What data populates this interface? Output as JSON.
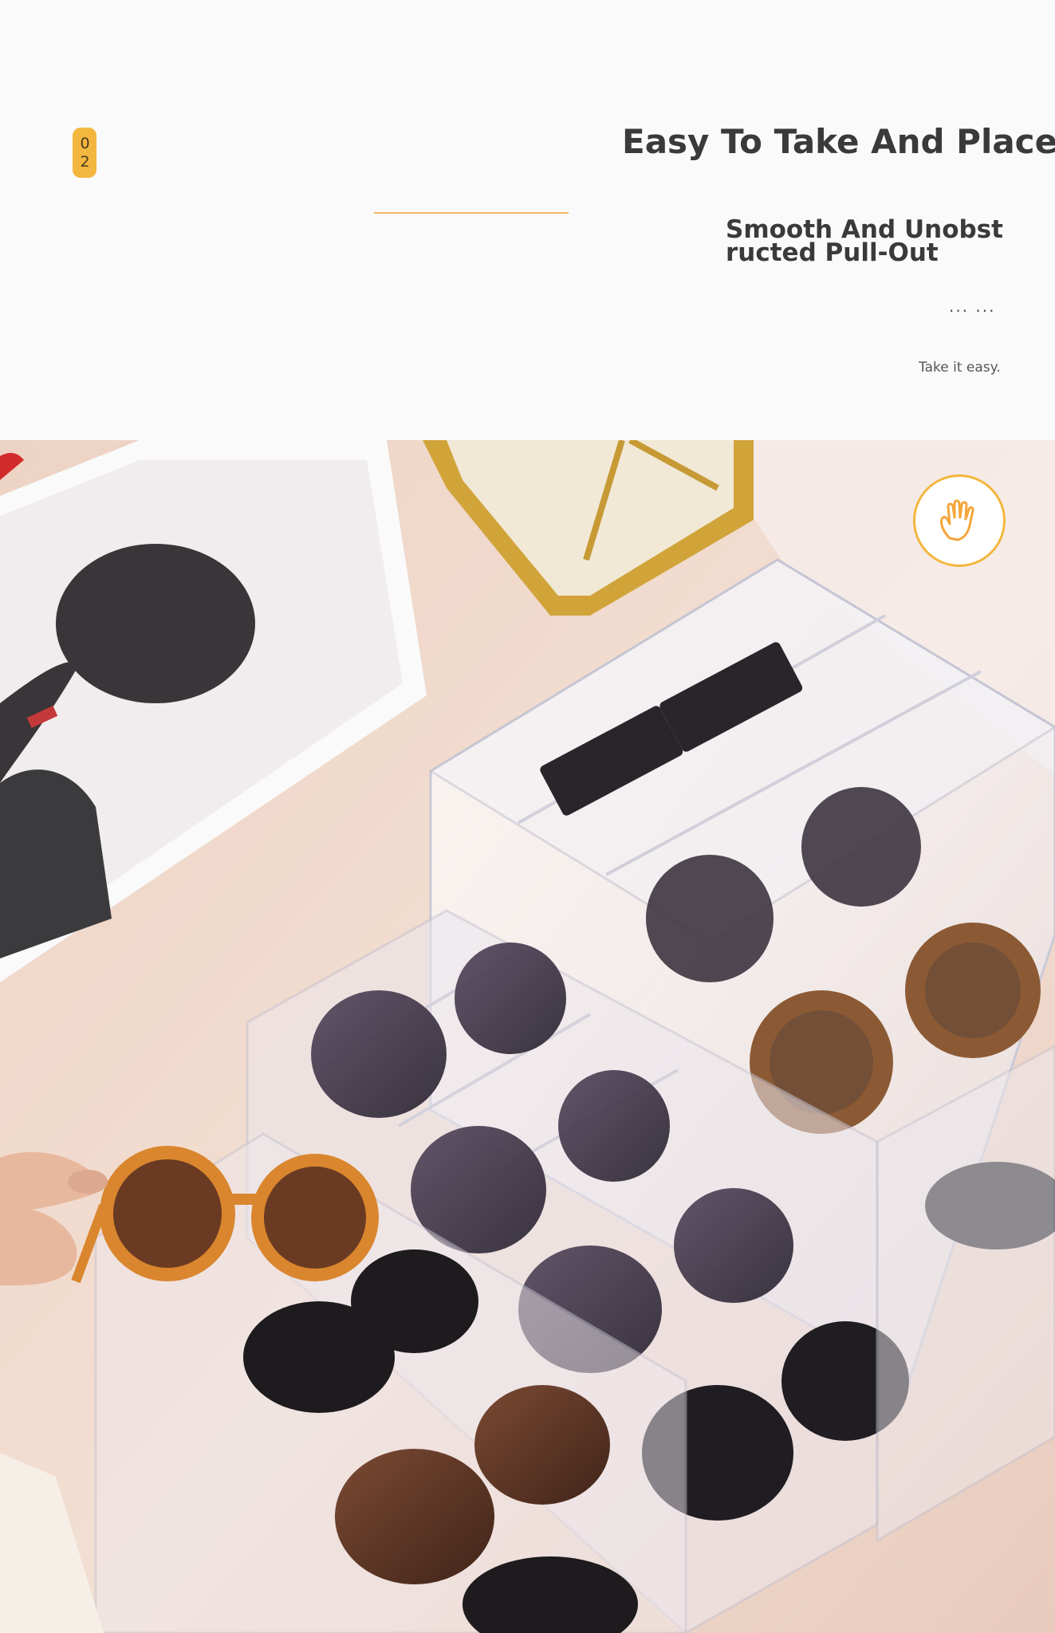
{
  "header": {
    "badge_number": "02",
    "title": "Easy To Take And Place",
    "subtitle_line1": "Smooth And Unobst",
    "subtitle_line2": "ructed Pull-Out",
    "dots": "... ...",
    "tagline": "Take it easy."
  },
  "photo": {
    "subject": "",
    "icon": "hand-icon"
  },
  "colors": {
    "accent": "#f3b73f",
    "text": "#3a3a3a",
    "background": "#fbfafa"
  }
}
